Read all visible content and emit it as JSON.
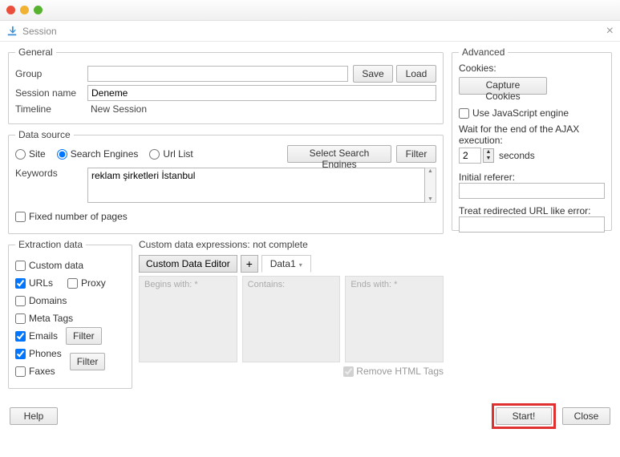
{
  "window": {
    "title": "Session"
  },
  "general": {
    "legend": "General",
    "group_label": "Group",
    "save": "Save",
    "load": "Load",
    "session_name_label": "Session name",
    "session_name_value": "Deneme",
    "timeline_label": "Timeline",
    "timeline_value": "New Session"
  },
  "datasource": {
    "legend": "Data source",
    "site": "Site",
    "search_engines": "Search Engines",
    "url_list": "Url List",
    "select_engines": "Select Search Engines",
    "filter": "Filter",
    "keywords_label": "Keywords",
    "keywords_value": "reklam şirketleri İstanbul",
    "fixed_pages": "Fixed number of pages"
  },
  "advanced": {
    "legend": "Advanced",
    "cookies_label": "Cookies:",
    "capture_cookies": "Capture Cookies",
    "use_js": "Use JavaScript engine",
    "wait_label": "Wait for the end of the AJAX execution:",
    "wait_value": "2",
    "seconds": "seconds",
    "initial_referer": "Initial referer:",
    "treat_redirect": "Treat redirected URL like error:"
  },
  "extraction": {
    "legend": "Extraction data",
    "custom_data": "Custom data",
    "urls": "URLs",
    "proxy": "Proxy",
    "domains": "Domains",
    "meta_tags": "Meta Tags",
    "emails": "Emails",
    "phones": "Phones",
    "faxes": "Faxes",
    "filter": "Filter"
  },
  "custom": {
    "header": "Custom data expressions: not complete",
    "editor_btn": "Custom Data Editor",
    "tab1": "Data1",
    "begins_with": "Begins with: *",
    "contains": "Contains:",
    "ends_with": "Ends with: *",
    "remove_tags": "Remove HTML Tags"
  },
  "footer": {
    "help": "Help",
    "start": "Start!",
    "close": "Close"
  }
}
